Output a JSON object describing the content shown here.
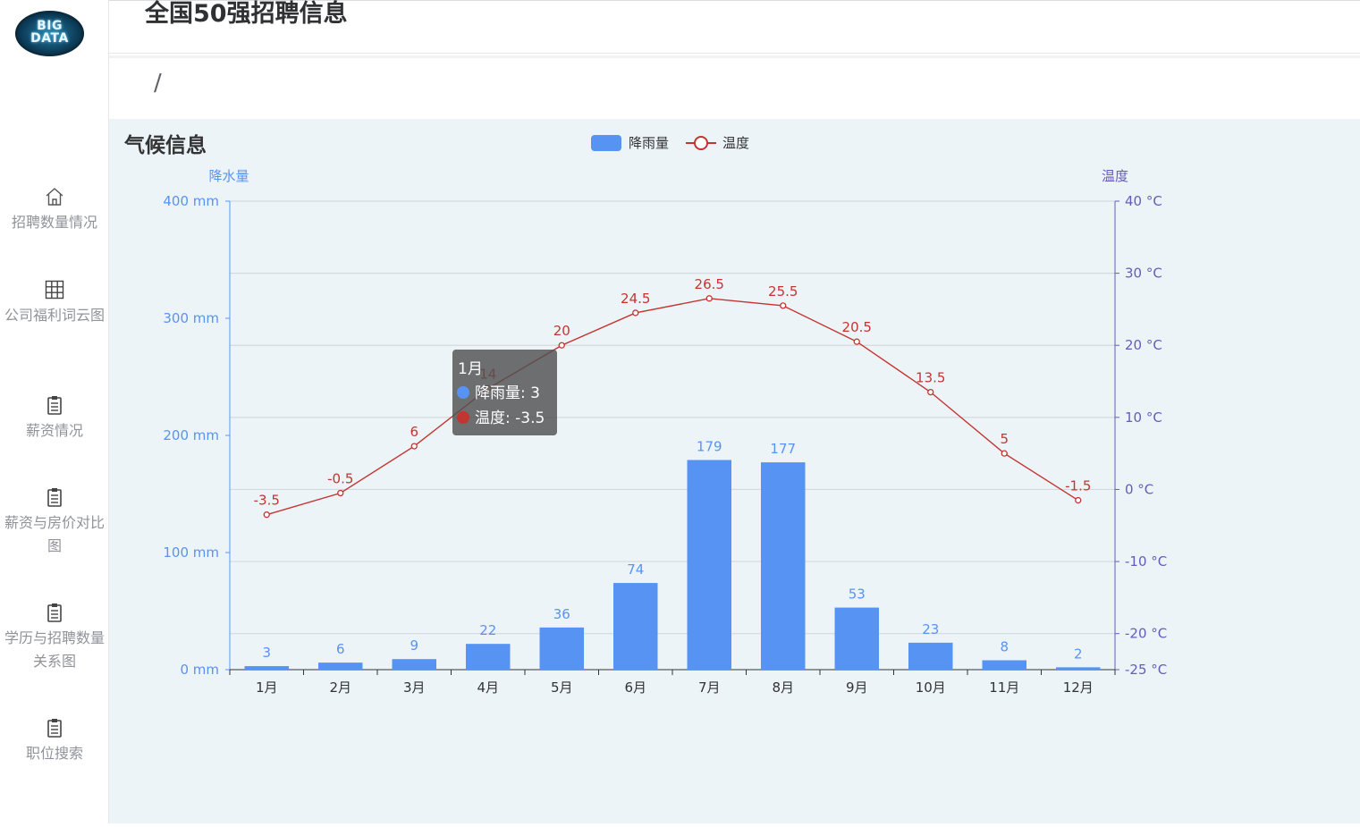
{
  "logo": {
    "line1": "BIG",
    "line2": "DATA"
  },
  "header": {
    "title": "全国50强招聘信息"
  },
  "breadcrumb": {
    "separator": "/"
  },
  "sidebar": {
    "items": [
      {
        "label": "招聘数量情况",
        "icon": "home-icon"
      },
      {
        "label": "公司福利词云图",
        "icon": "grid-icon"
      },
      {
        "label": "薪资情况",
        "icon": "clipboard-icon"
      },
      {
        "label": "薪资与房价对比图",
        "icon": "clipboard-icon"
      },
      {
        "label": "学历与招聘数量关系图",
        "icon": "clipboard-icon"
      },
      {
        "label": "职位搜索",
        "icon": "clipboard-icon"
      }
    ]
  },
  "colors": {
    "bar": "#5793f3",
    "line": "#c23531",
    "left_axis": "#5793f3",
    "right_axis": "#675bba"
  },
  "chart_data": {
    "type": "bar",
    "title": "气候信息",
    "categories": [
      "1月",
      "2月",
      "3月",
      "4月",
      "5月",
      "6月",
      "7月",
      "8月",
      "9月",
      "10月",
      "11月",
      "12月"
    ],
    "series": [
      {
        "name": "降雨量",
        "type": "bar",
        "axis": "left",
        "values": [
          3,
          6,
          9,
          22,
          36,
          74,
          179,
          177,
          53,
          23,
          8,
          2
        ]
      },
      {
        "name": "温度",
        "type": "line",
        "axis": "right",
        "values": [
          -3.5,
          -0.5,
          6,
          14,
          20,
          24.5,
          26.5,
          25.5,
          20.5,
          13.5,
          5,
          -1.5
        ]
      }
    ],
    "left_axis": {
      "label": "降水量",
      "unit": "mm",
      "range": [
        0,
        400
      ],
      "ticks": [
        0,
        100,
        200,
        300,
        400
      ]
    },
    "right_axis": {
      "label": "温度",
      "unit": "°C",
      "range": [
        -25,
        40
      ],
      "ticks": [
        -25,
        -20,
        -10,
        0,
        10,
        20,
        30,
        40
      ]
    },
    "legend": {
      "placement": "top-center",
      "items": [
        "降雨量",
        "温度"
      ]
    },
    "grid": true,
    "tooltip": {
      "category": "1月",
      "lines": [
        "降雨量: 3",
        "温度: -3.5"
      ]
    }
  }
}
